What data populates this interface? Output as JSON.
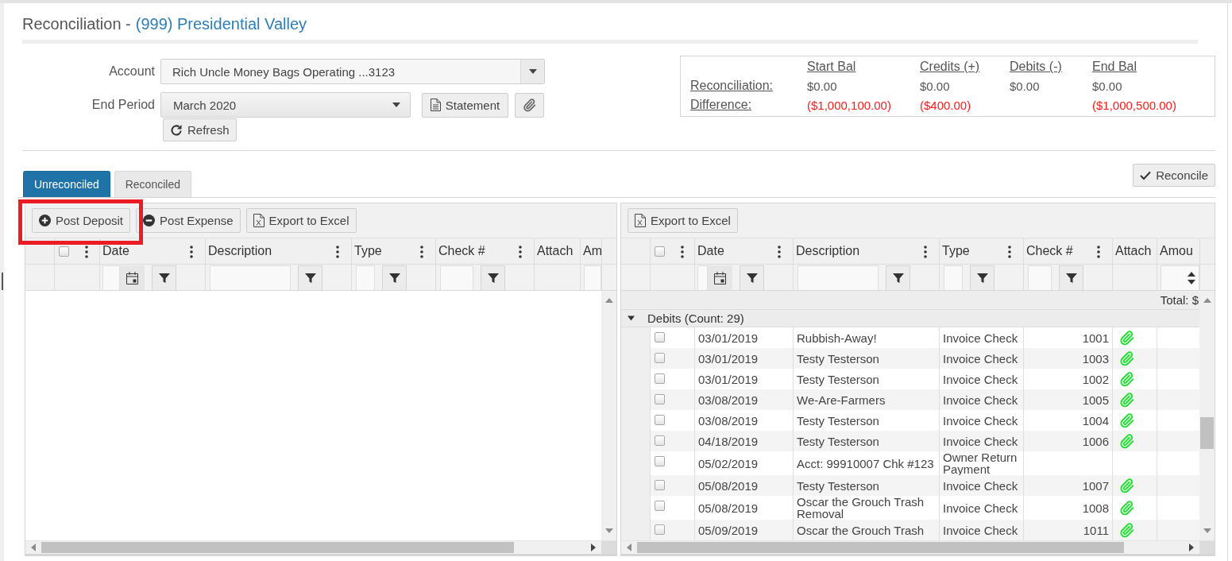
{
  "page": {
    "title": "Reconciliation -",
    "property": "(999) Presidential Valley"
  },
  "form": {
    "account": {
      "label": "Account",
      "value": "Rich Uncle Money Bags Operating ...3123"
    },
    "end_period": {
      "label": "End Period",
      "value": "March 2020"
    },
    "statement_button": "Statement",
    "refresh_button": "Refresh"
  },
  "summary": {
    "columns": [
      "Start Bal",
      "Credits (+)",
      "Debits (-)",
      "End Bal"
    ],
    "rows": [
      {
        "label": "Reconciliation:",
        "negative": false,
        "start_bal": "$0.00",
        "credits": "$0.00",
        "debits": "$0.00",
        "end_bal": "$0.00"
      },
      {
        "label": "Difference:",
        "negative": true,
        "start_bal": "($1,000,100.00)",
        "credits": "($400.00)",
        "end_bal": "($1,000,500.00)"
      }
    ]
  },
  "tabs": [
    {
      "label": "Unreconciled",
      "selected": true
    },
    {
      "label": "Reconciled",
      "selected": false
    }
  ],
  "reconcile_button": "Reconcile",
  "grids": [
    {
      "toolbar": [
        {
          "kind": "add",
          "label": "Post Deposit",
          "highlighted": true
        },
        {
          "kind": "remove",
          "label": "Post Expense",
          "highlighted": false
        },
        {
          "kind": "export",
          "label": "Export to Excel",
          "highlighted": false
        }
      ],
      "header_checkbox": {
        "checked": false
      },
      "columns": [
        {
          "label": "Date",
          "kind": "date"
        },
        {
          "label": "Description",
          "kind": "text"
        },
        {
          "label": "Type",
          "kind": "text"
        },
        {
          "label": "Check #",
          "kind": "text"
        },
        {
          "label": "Attach",
          "kind": "icon"
        },
        {
          "label": "Am",
          "kind": "number"
        }
      ]
    },
    {
      "toolbar": [
        {
          "kind": "export",
          "label": "Export to Excel",
          "highlighted": false
        }
      ],
      "header_checkbox": {
        "checked": false
      },
      "columns": [
        {
          "label": "Date",
          "kind": "date"
        },
        {
          "label": "Description",
          "kind": "text"
        },
        {
          "label": "Type",
          "kind": "text"
        },
        {
          "label": "Check #",
          "kind": "text"
        },
        {
          "label": "Attach",
          "kind": "icon"
        },
        {
          "label": "Amou",
          "kind": "number"
        }
      ],
      "total": "Total: $",
      "groups": [
        {
          "label": "Debits (Count: 29)",
          "expanded": true,
          "rows": [
            {
              "checked": false,
              "date": "03/01/2019",
              "description": "Rubbish-Away!",
              "type": "Invoice Check",
              "check": "1001",
              "attached": true
            },
            {
              "checked": false,
              "date": "03/01/2019",
              "description": "Testy Testerson",
              "type": "Invoice Check",
              "check": "1003",
              "attached": true
            },
            {
              "checked": false,
              "date": "03/01/2019",
              "description": "Testy Testerson",
              "type": "Invoice Check",
              "check": "1002",
              "attached": true
            },
            {
              "checked": false,
              "date": "03/08/2019",
              "description": "We-Are-Farmers",
              "type": "Invoice Check",
              "check": "1005",
              "attached": true
            },
            {
              "checked": false,
              "date": "03/08/2019",
              "description": "Testy Testerson",
              "type": "Invoice Check",
              "check": "1004",
              "attached": true
            },
            {
              "checked": false,
              "date": "04/18/2019",
              "description": "Testy Testerson",
              "type": "Invoice Check",
              "check": "1006",
              "attached": true
            },
            {
              "checked": false,
              "date": "05/02/2019",
              "description": "Acct: 99910007 Chk #123",
              "type": "Owner Return Payment",
              "attached": false
            },
            {
              "checked": false,
              "date": "05/08/2019",
              "description": "Testy Testerson",
              "type": "Invoice Check",
              "check": "1007",
              "attached": true
            },
            {
              "checked": false,
              "date": "05/08/2019",
              "description": "Oscar the Grouch Trash Removal",
              "type": "Invoice Check",
              "check": "1008",
              "attached": true
            },
            {
              "checked": false,
              "date": "05/09/2019",
              "description": "Oscar the Grouch Trash",
              "type": "Invoice Check",
              "check": "1011",
              "attached": true
            }
          ]
        }
      ]
    }
  ]
}
